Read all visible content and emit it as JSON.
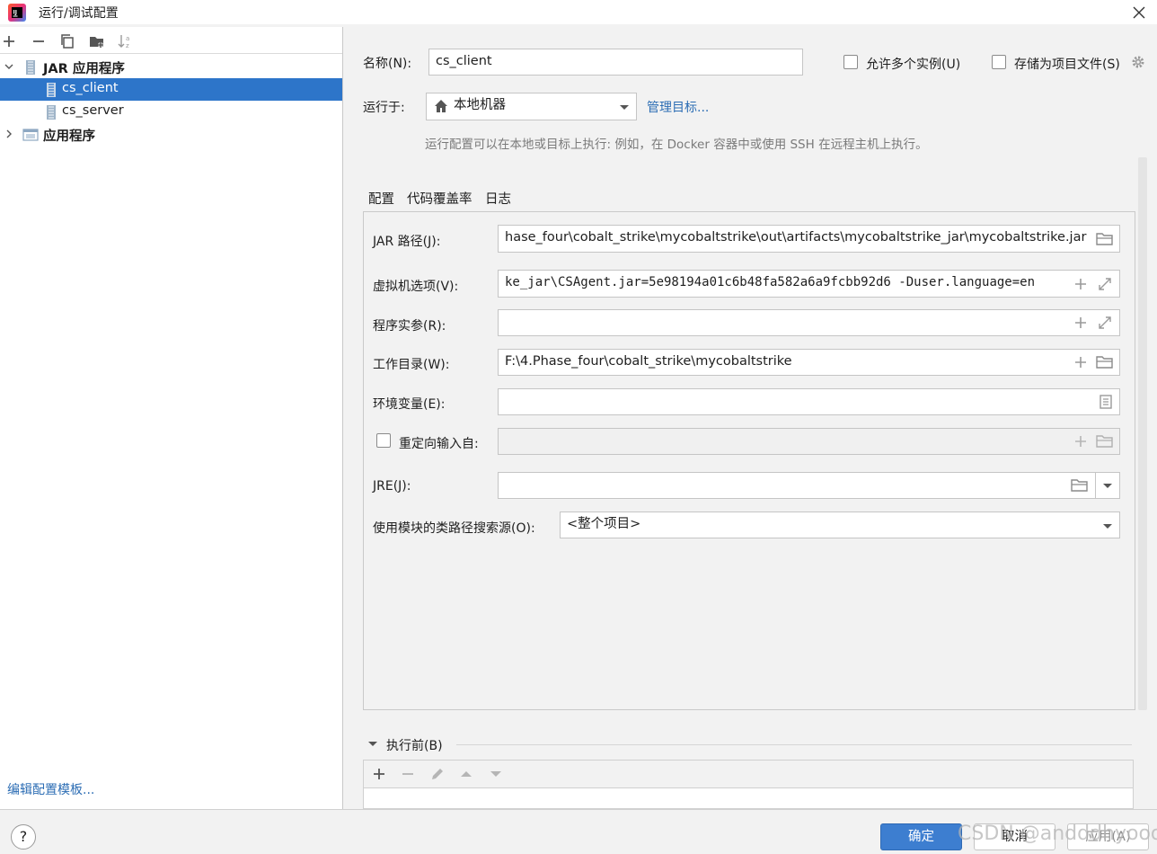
{
  "window": {
    "title": "运行/调试配置"
  },
  "left": {
    "tree": [
      {
        "label": "JAR 应用程序",
        "expanded": true
      },
      {
        "label": "cs_client",
        "selected": true
      },
      {
        "label": "cs_server"
      },
      {
        "label": "应用程序",
        "expanded": false
      }
    ],
    "edit_templates": "编辑配置模板..."
  },
  "form": {
    "name_label": "名称(N):",
    "name_value": "cs_client",
    "allow_multiple": "允许多个实例(U)",
    "store_as_file": "存储为项目文件(S)",
    "run_on_label": "运行于:",
    "run_on_value": "本地机器",
    "manage_targets": "管理目标...",
    "hint": "运行配置可以在本地或目标上执行: 例如，在 Docker 容器中或使用 SSH 在远程主机上执行。"
  },
  "tabs": [
    "配置",
    "代码覆盖率",
    "日志"
  ],
  "config": {
    "jar_label": "JAR 路径(J):",
    "jar_value": "hase_four\\cobalt_strike\\mycobaltstrike\\out\\artifacts\\mycobaltstrike_jar\\mycobaltstrike.jar",
    "vm_label": "虚拟机选项(V):",
    "vm_value": "ke_jar\\CSAgent.jar=5e98194a01c6b48fa582a6a9fcbb92d6 -Duser.language=en",
    "args_label": "程序实参(R):",
    "args_value": "",
    "workdir_label": "工作目录(W):",
    "workdir_value": "F:\\4.Phase_four\\cobalt_strike\\mycobaltstrike",
    "env_label": "环境变量(E):",
    "env_value": "",
    "redirect_label": "重定向输入自:",
    "jre_label": "JRE(J):",
    "jre_value": "",
    "module_label": "使用模块的类路径搜索源(O):",
    "module_value": "<整个项目>"
  },
  "before_launch": {
    "label": "执行前(B)"
  },
  "buttons": {
    "help": "?",
    "ok": "确定",
    "cancel": "取消",
    "apply": "应用(A)"
  },
  "watermark": "CSDN @andddhyooo",
  "colors": {
    "selection": "#2d75c9",
    "accent": "#3574f0",
    "link": "#2c6db4",
    "primary_button": "#3d7ed0"
  }
}
